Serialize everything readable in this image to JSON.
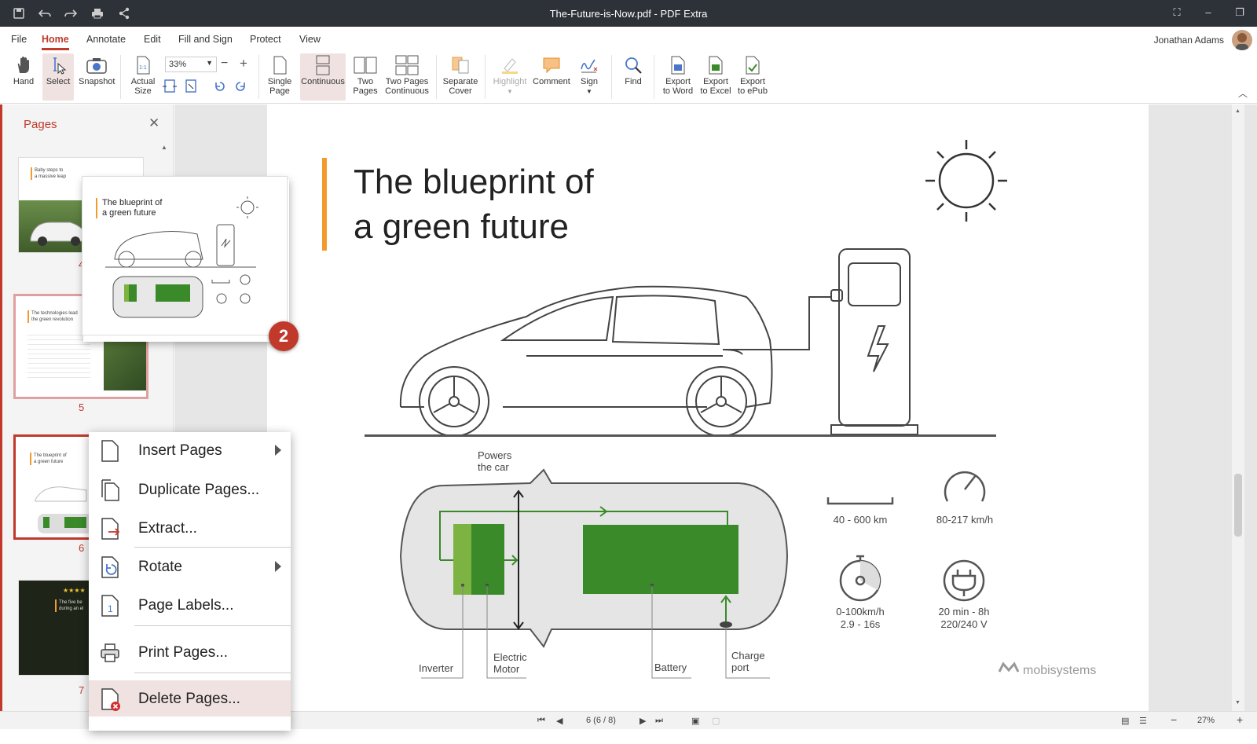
{
  "titlebar": {
    "title": "The-Future-is-Now.pdf - PDF Extra"
  },
  "menu": {
    "items": [
      "File",
      "Home",
      "Annotate",
      "Edit",
      "Fill and Sign",
      "Protect",
      "View"
    ],
    "active": "Home",
    "user": "Jonathan Adams"
  },
  "ribbon": {
    "hand": "Hand",
    "select": "Select",
    "snapshot": "Snapshot",
    "actual_size": [
      "Actual",
      "Size"
    ],
    "zoom_value": "33%",
    "single_page": [
      "Single",
      "Page"
    ],
    "continuous": "Continuous",
    "two_pages": [
      "Two",
      "Pages"
    ],
    "two_pages_continuous": [
      "Two Pages",
      "Continuous"
    ],
    "separate_cover": [
      "Separate",
      "Cover"
    ],
    "highlight": "Highlight",
    "comment": "Comment",
    "sign": "Sign",
    "find": "Find",
    "export_word": [
      "Export",
      "to Word"
    ],
    "export_excel": [
      "Export",
      "to Excel"
    ],
    "export_epub": [
      "Export",
      "to ePub"
    ]
  },
  "pages_panel": {
    "title": "Pages",
    "thumbs": [
      {
        "caption": [
          "Baby steps to",
          "a massive leap"
        ],
        "num": "4"
      },
      {
        "caption": [
          "The technologies lead",
          "the green revolution"
        ],
        "num": "5"
      },
      {
        "caption": [
          "The blueprint of",
          "a green future"
        ],
        "num": "6"
      },
      {
        "caption": [
          "The five be",
          "during an el"
        ],
        "num": "7"
      }
    ]
  },
  "preview": {
    "title": [
      "The blueprint of",
      "a green future"
    ],
    "badge": "2"
  },
  "context_menu": {
    "items": [
      {
        "label": "Insert Pages",
        "submenu": true
      },
      {
        "label": "Duplicate Pages...",
        "submenu": false
      },
      {
        "label": "Extract...",
        "submenu": false
      },
      {
        "label": "Rotate",
        "submenu": true
      },
      {
        "label": "Page Labels...",
        "submenu": false
      },
      {
        "label": "Print Pages...",
        "submenu": false
      },
      {
        "label": "Delete Pages...",
        "submenu": false
      }
    ],
    "highlighted": "Delete Pages..."
  },
  "document": {
    "title_line1": "The blueprint of",
    "title_line2": "a green future",
    "powers": [
      "Powers",
      "the car"
    ],
    "labels": {
      "inverter": "Inverter",
      "motor": [
        "Electric",
        "Motor"
      ],
      "battery": "Battery",
      "charge": [
        "Charge",
        "port"
      ]
    },
    "stats": {
      "range": "40 - 600 km",
      "speed": "80-217 km/h",
      "accel": [
        "0-100km/h",
        "2.9 - 16s"
      ],
      "charge": [
        "20 min - 8h",
        "220/240 V"
      ]
    },
    "brand": "mobisystems",
    "accent": "#f39a2c",
    "green_dark": "#3a8a2a",
    "green_light": "#7cb342"
  },
  "status": {
    "page": "6 (6 / 8)",
    "zoom": "27%"
  }
}
